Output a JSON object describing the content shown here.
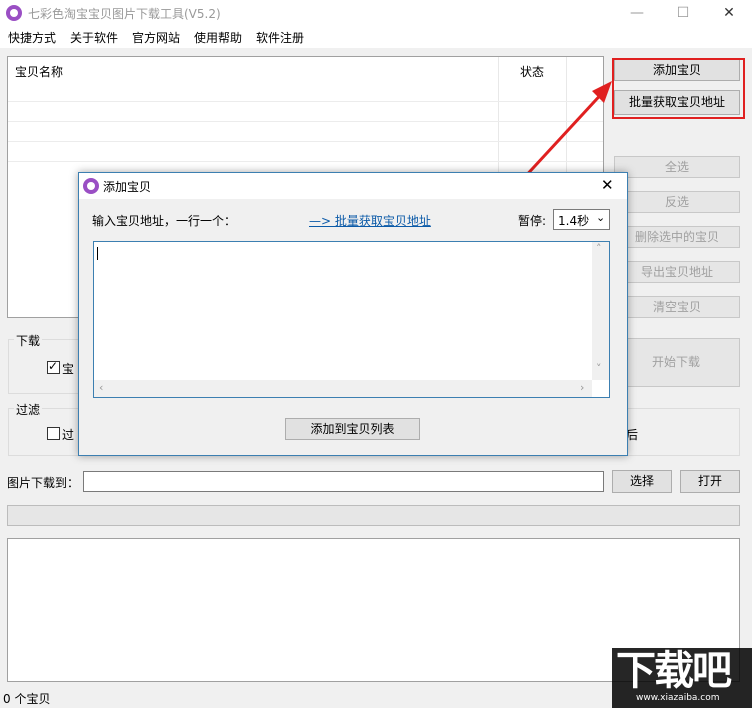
{
  "window": {
    "title": "七彩色淘宝宝贝图片下载工具(V5.2)",
    "minimize_glyph": "—",
    "maximize_glyph": "☐",
    "close_glyph": "✕"
  },
  "menu": [
    "快捷方式",
    "关于软件",
    "官方网站",
    "使用帮助",
    "软件注册"
  ],
  "table": {
    "columns": [
      "宝贝名称",
      "状态"
    ]
  },
  "right_buttons": {
    "add": "添加宝贝",
    "batch": "批量获取宝贝地址",
    "select_all": "全选",
    "invert": "反选",
    "delete_selected": "删除选中的宝贝",
    "export": "导出宝贝地址",
    "clear": "清空宝贝",
    "start": "开始下载"
  },
  "groups": {
    "download_label": "下载",
    "download_checkbox_partial": "宝",
    "filter_label": "过滤",
    "filter_checkbox_partial": "过",
    "filter_right_partial": "后"
  },
  "download_path": {
    "label": "图片下载到：",
    "value": "",
    "select_btn": "选择",
    "open_btn": "打开"
  },
  "status": {
    "count_text": "0 个宝贝"
  },
  "dialog": {
    "title": "添加宝贝",
    "close_glyph": "✕",
    "input_label": "输入宝贝地址，一行一个：",
    "batch_link": "—> 批量获取宝贝地址",
    "pause_label": "暂停:",
    "pause_value": "1.4秒",
    "textarea_value": "",
    "add_to_list_btn": "添加到宝贝列表"
  },
  "watermark": {
    "text": "下载吧",
    "url": "www.xiazaiba.com"
  },
  "colors": {
    "accent_red": "#e02020",
    "link_blue": "#0b5aa8",
    "dialog_border": "#3c7fb1"
  }
}
